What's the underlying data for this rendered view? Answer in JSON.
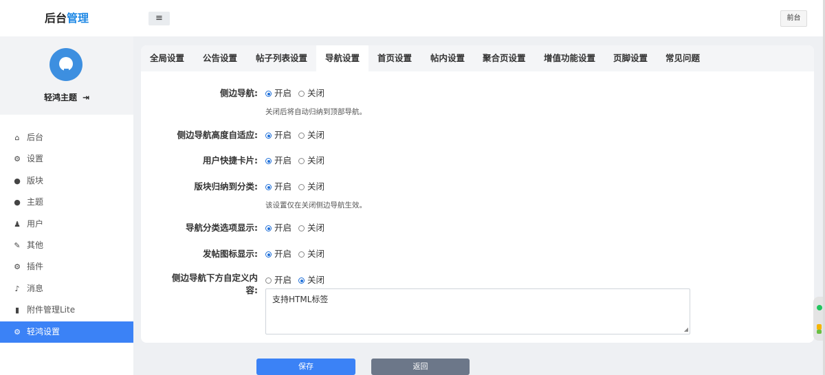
{
  "header": {
    "brand_prefix": "后台",
    "brand_accent": "管理",
    "menu_toggle_icon": "≡",
    "front_button": "前台"
  },
  "sidebar": {
    "username": "轻鸿主题",
    "logout_icon": "⇥",
    "items": [
      {
        "label": "后台",
        "icon": "home-icon",
        "glyph": "⌂"
      },
      {
        "label": "设置",
        "icon": "gear-icon",
        "glyph": "⚙"
      },
      {
        "label": "版块",
        "icon": "comment-icon",
        "glyph": "●"
      },
      {
        "label": "主题",
        "icon": "comment-icon",
        "glyph": "●"
      },
      {
        "label": "用户",
        "icon": "user-icon",
        "glyph": "♟"
      },
      {
        "label": "其他",
        "icon": "wrench-icon",
        "glyph": "✎"
      },
      {
        "label": "插件",
        "icon": "cogs-icon",
        "glyph": "⚙"
      },
      {
        "label": "消息",
        "icon": "bell-icon",
        "glyph": "♪"
      },
      {
        "label": "附件管理Lite",
        "icon": "file-icon",
        "glyph": "▮"
      },
      {
        "label": "轻鸿设置",
        "icon": "gear-icon",
        "glyph": "⚙",
        "active": true
      }
    ]
  },
  "tabs": [
    {
      "label": "全局设置"
    },
    {
      "label": "公告设置"
    },
    {
      "label": "帖子列表设置"
    },
    {
      "label": "导航设置",
      "active": true
    },
    {
      "label": "首页设置"
    },
    {
      "label": "帖内设置"
    },
    {
      "label": "聚合页设置"
    },
    {
      "label": "增值功能设置"
    },
    {
      "label": "页脚设置"
    },
    {
      "label": "常见问题"
    }
  ],
  "form": {
    "on_label": "开启",
    "off_label": "关闭",
    "rows": [
      {
        "label": "侧边导航:",
        "value": "on",
        "hint": "关闭后将自动归纳到顶部导航。"
      },
      {
        "label": "侧边导航高度自适应:",
        "value": "on"
      },
      {
        "label": "用户快捷卡片:",
        "value": "on"
      },
      {
        "label": "版块归纳到分类:",
        "value": "on",
        "hint": "该设置仅在关闭侧边导航生效。"
      },
      {
        "label": "导航分类选项显示:",
        "value": "on"
      },
      {
        "label": "发帖图标显示:",
        "value": "on"
      },
      {
        "label": "侧边导航下方自定义内",
        "label_line2": "容:",
        "value": "off"
      }
    ],
    "textarea_placeholder": "支持HTML标签"
  },
  "buttons": {
    "save": "保存",
    "back": "返回"
  }
}
